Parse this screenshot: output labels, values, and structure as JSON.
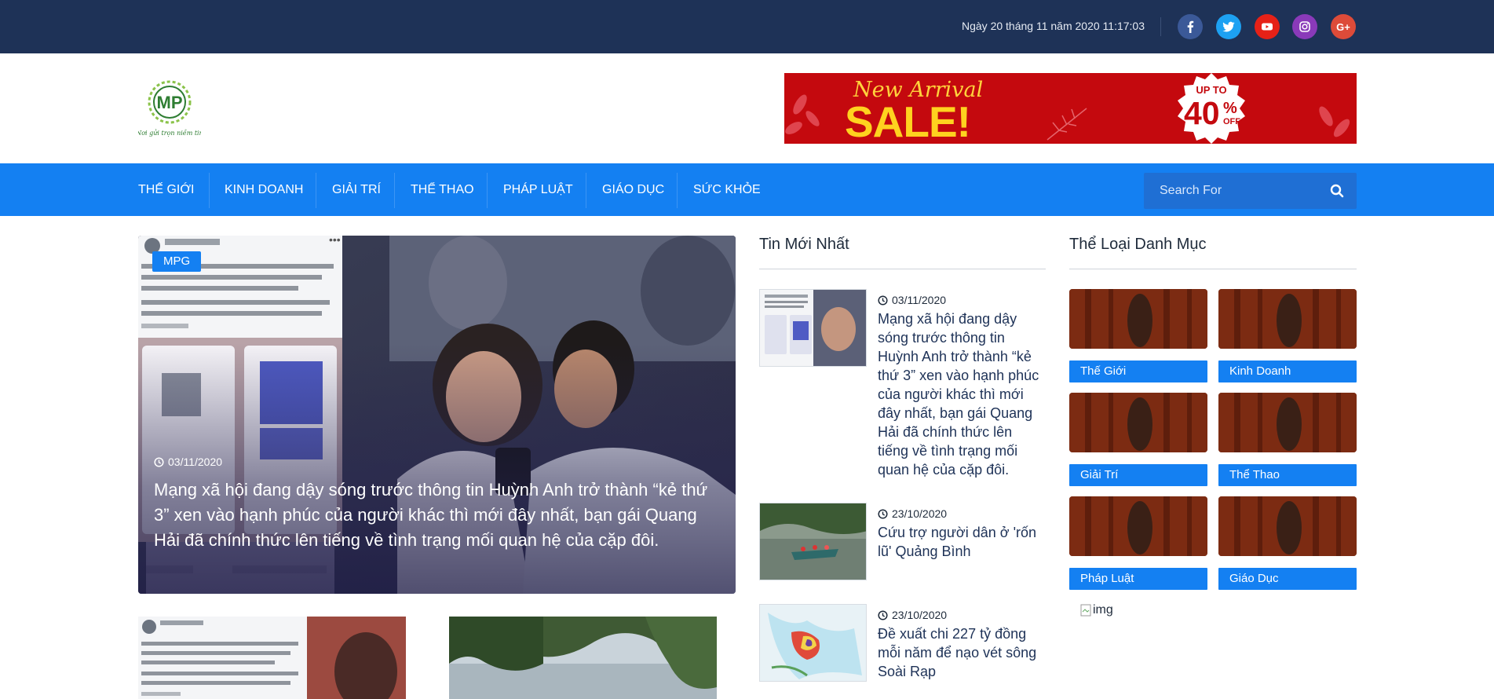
{
  "topbar": {
    "datetime": "Ngày 20 tháng 11 năm 2020 11:17:03",
    "social": [
      {
        "name": "facebook",
        "color": "#3b5998"
      },
      {
        "name": "twitter",
        "color": "#1da1f2"
      },
      {
        "name": "youtube",
        "color": "#e62117"
      },
      {
        "name": "instagram",
        "color": "#8a3ab9"
      },
      {
        "name": "google-plus",
        "color": "#dd4b39"
      }
    ]
  },
  "header": {
    "logo_text": "MP",
    "logo_tagline": "Nơi gửi trọn niềm tin",
    "banner": {
      "headline": "New Arrival",
      "sale": "SALE!",
      "upto": "UP TO",
      "percent": "40",
      "percent_sign": "%",
      "off": "OFF"
    }
  },
  "nav": {
    "items": [
      "THẾ GIỚI",
      "KINH DOANH",
      "GIẢI TRÍ",
      "THỂ THAO",
      "PHÁP LUẬT",
      "GIÁO DỤC",
      "SỨC KHỎE"
    ],
    "search_placeholder": "Search For"
  },
  "hero": {
    "tag": "MPG",
    "date": "03/11/2020",
    "title": "Mạng xã hội đang dậy sóng trước thông tin Huỳnh Anh trở thành “kẻ thứ 3” xen vào hạnh phúc của người khác thì mới đây nhất, bạn gái Quang Hải đã chính thức lên tiếng về tình trạng mối quan hệ của cặp đôi."
  },
  "latest": {
    "heading": "Tin Mới Nhất",
    "items": [
      {
        "date": "03/11/2020",
        "title": "Mạng xã hội đang dậy sóng trước thông tin Huỳnh Anh trở thành “kẻ thứ 3” xen vào hạnh phúc của người khác thì mới đây nhất, bạn gái Quang Hải đã chính thức lên tiếng về tình trạng mối quan hệ của cặp đôi."
      },
      {
        "date": "23/10/2020",
        "title": "Cứu trợ người dân ở 'rốn lũ' Quảng Bình"
      },
      {
        "date": "23/10/2020",
        "title": "Đề xuất chi 227 tỷ đồng mỗi năm để nạo vét sông Soài Rạp"
      }
    ]
  },
  "categories": {
    "heading": "Thể Loại Danh Mục",
    "items": [
      "Thế Giới",
      "Kinh Doanh",
      "Giải Trí",
      "Thể Thao",
      "Pháp Luật",
      "Giáo Dục"
    ],
    "broken_img_alt": "img"
  }
}
